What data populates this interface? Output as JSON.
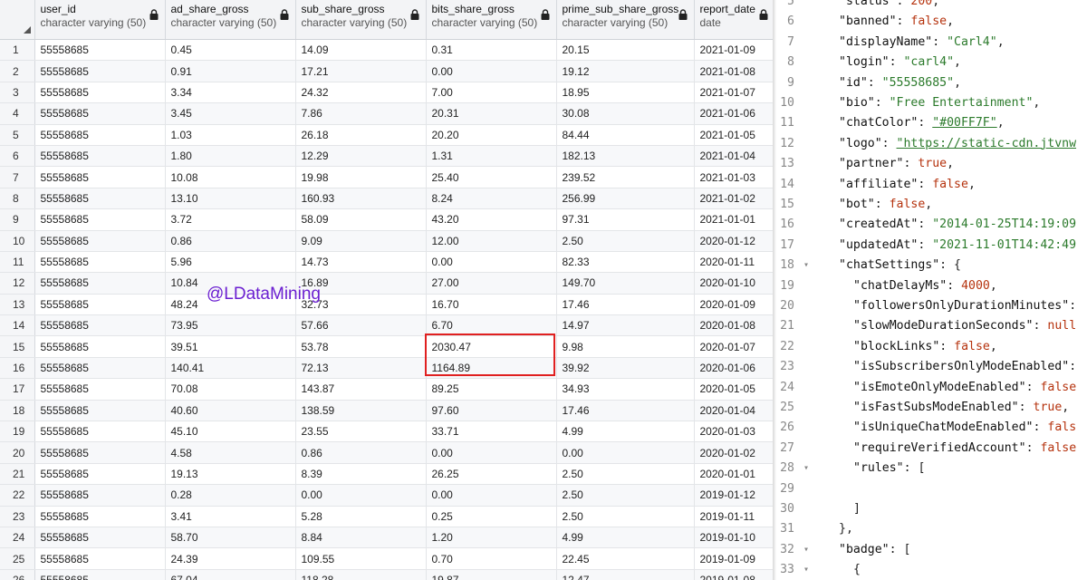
{
  "grid": {
    "columns": [
      {
        "name": "user_id",
        "type": "character varying (50)",
        "locked": true
      },
      {
        "name": "ad_share_gross",
        "type": "character varying (50)",
        "locked": true
      },
      {
        "name": "sub_share_gross",
        "type": "character varying (50)",
        "locked": true
      },
      {
        "name": "bits_share_gross",
        "type": "character varying (50)",
        "locked": true
      },
      {
        "name": "prime_sub_share_gross",
        "type": "character varying (50)",
        "locked": true
      },
      {
        "name": "report_date",
        "type": "date",
        "locked": true
      }
    ],
    "rows": [
      [
        "1",
        "55558685",
        "0.45",
        "14.09",
        "0.31",
        "20.15",
        "2021-01-09"
      ],
      [
        "2",
        "55558685",
        "0.91",
        "17.21",
        "0.00",
        "19.12",
        "2021-01-08"
      ],
      [
        "3",
        "55558685",
        "3.34",
        "24.32",
        "7.00",
        "18.95",
        "2021-01-07"
      ],
      [
        "4",
        "55558685",
        "3.45",
        "7.86",
        "20.31",
        "30.08",
        "2021-01-06"
      ],
      [
        "5",
        "55558685",
        "1.03",
        "26.18",
        "20.20",
        "84.44",
        "2021-01-05"
      ],
      [
        "6",
        "55558685",
        "1.80",
        "12.29",
        "1.31",
        "182.13",
        "2021-01-04"
      ],
      [
        "7",
        "55558685",
        "10.08",
        "19.98",
        "25.40",
        "239.52",
        "2021-01-03"
      ],
      [
        "8",
        "55558685",
        "13.10",
        "160.93",
        "8.24",
        "256.99",
        "2021-01-02"
      ],
      [
        "9",
        "55558685",
        "3.72",
        "58.09",
        "43.20",
        "97.31",
        "2021-01-01"
      ],
      [
        "10",
        "55558685",
        "0.86",
        "9.09",
        "12.00",
        "2.50",
        "2020-01-12"
      ],
      [
        "11",
        "55558685",
        "5.96",
        "14.73",
        "0.00",
        "82.33",
        "2020-01-11"
      ],
      [
        "12",
        "55558685",
        "10.84",
        "16.89",
        "27.00",
        "149.70",
        "2020-01-10"
      ],
      [
        "13",
        "55558685",
        "48.24",
        "32.73",
        "16.70",
        "17.46",
        "2020-01-09"
      ],
      [
        "14",
        "55558685",
        "73.95",
        "57.66",
        "6.70",
        "14.97",
        "2020-01-08"
      ],
      [
        "15",
        "55558685",
        "39.51",
        "53.78",
        "2030.47",
        "9.98",
        "2020-01-07"
      ],
      [
        "16",
        "55558685",
        "140.41",
        "72.13",
        "1164.89",
        "39.92",
        "2020-01-06"
      ],
      [
        "17",
        "55558685",
        "70.08",
        "143.87",
        "89.25",
        "34.93",
        "2020-01-05"
      ],
      [
        "18",
        "55558685",
        "40.60",
        "138.59",
        "97.60",
        "17.46",
        "2020-01-04"
      ],
      [
        "19",
        "55558685",
        "45.10",
        "23.55",
        "33.71",
        "4.99",
        "2020-01-03"
      ],
      [
        "20",
        "55558685",
        "4.58",
        "0.86",
        "0.00",
        "0.00",
        "2020-01-02"
      ],
      [
        "21",
        "55558685",
        "19.13",
        "8.39",
        "26.25",
        "2.50",
        "2020-01-01"
      ],
      [
        "22",
        "55558685",
        "0.28",
        "0.00",
        "0.00",
        "2.50",
        "2019-01-12"
      ],
      [
        "23",
        "55558685",
        "3.41",
        "5.28",
        "0.25",
        "2.50",
        "2019-01-11"
      ],
      [
        "24",
        "55558685",
        "58.70",
        "8.84",
        "1.20",
        "4.99",
        "2019-01-10"
      ],
      [
        "25",
        "55558685",
        "24.39",
        "109.55",
        "0.70",
        "22.45",
        "2019-01-09"
      ],
      [
        "26",
        "55558685",
        "67.04",
        "118.28",
        "19.87",
        "12.47",
        "2019-01-08"
      ]
    ],
    "watermark": "@LDataMining"
  },
  "code": {
    "lines": [
      {
        "n": "5",
        "fold": false,
        "tokens": [
          [
            "k",
            "\"status\""
          ],
          [
            "p",
            ": "
          ],
          [
            "n",
            "200"
          ],
          [
            "p",
            ","
          ]
        ]
      },
      {
        "n": "6",
        "fold": false,
        "tokens": [
          [
            "k",
            "\"banned\""
          ],
          [
            "p",
            ": "
          ],
          [
            "b",
            "false"
          ],
          [
            "p",
            ","
          ]
        ]
      },
      {
        "n": "7",
        "fold": false,
        "tokens": [
          [
            "k",
            "\"displayName\""
          ],
          [
            "p",
            ": "
          ],
          [
            "s",
            "\"Carl4\""
          ],
          [
            "p",
            ","
          ]
        ]
      },
      {
        "n": "8",
        "fold": false,
        "tokens": [
          [
            "k",
            "\"login\""
          ],
          [
            "p",
            ": "
          ],
          [
            "s",
            "\"carl4\""
          ],
          [
            "p",
            ","
          ]
        ]
      },
      {
        "n": "9",
        "fold": false,
        "tokens": [
          [
            "k",
            "\"id\""
          ],
          [
            "p",
            ": "
          ],
          [
            "s",
            "\"55558685\""
          ],
          [
            "p",
            ","
          ]
        ]
      },
      {
        "n": "10",
        "fold": false,
        "tokens": [
          [
            "k",
            "\"bio\""
          ],
          [
            "p",
            ": "
          ],
          [
            "s",
            "\"Free Entertainment\""
          ],
          [
            "p",
            ","
          ]
        ]
      },
      {
        "n": "11",
        "fold": false,
        "tokens": [
          [
            "k",
            "\"chatColor\""
          ],
          [
            "p",
            ": "
          ],
          [
            "u",
            "\"#00FF7F\""
          ],
          [
            "p",
            ","
          ]
        ]
      },
      {
        "n": "12",
        "fold": false,
        "tokens": [
          [
            "k",
            "\"logo\""
          ],
          [
            "p",
            ": "
          ],
          [
            "u",
            "\"https://static-cdn.jtvnw"
          ]
        ]
      },
      {
        "n": "13",
        "fold": false,
        "tokens": [
          [
            "k",
            "\"partner\""
          ],
          [
            "p",
            ": "
          ],
          [
            "b",
            "true"
          ],
          [
            "p",
            ","
          ]
        ]
      },
      {
        "n": "14",
        "fold": false,
        "tokens": [
          [
            "k",
            "\"affiliate\""
          ],
          [
            "p",
            ": "
          ],
          [
            "b",
            "false"
          ],
          [
            "p",
            ","
          ]
        ]
      },
      {
        "n": "15",
        "fold": false,
        "tokens": [
          [
            "k",
            "\"bot\""
          ],
          [
            "p",
            ": "
          ],
          [
            "b",
            "false"
          ],
          [
            "p",
            ","
          ]
        ]
      },
      {
        "n": "16",
        "fold": false,
        "tokens": [
          [
            "k",
            "\"createdAt\""
          ],
          [
            "p",
            ": "
          ],
          [
            "s",
            "\"2014-01-25T14:19:09"
          ]
        ]
      },
      {
        "n": "17",
        "fold": false,
        "tokens": [
          [
            "k",
            "\"updatedAt\""
          ],
          [
            "p",
            ": "
          ],
          [
            "s",
            "\"2021-11-01T14:42:49"
          ]
        ]
      },
      {
        "n": "18",
        "fold": true,
        "tokens": [
          [
            "k",
            "\"chatSettings\""
          ],
          [
            "p",
            ": {"
          ]
        ]
      },
      {
        "n": "19",
        "fold": false,
        "indent": 1,
        "tokens": [
          [
            "k",
            "\"chatDelayMs\""
          ],
          [
            "p",
            ": "
          ],
          [
            "n",
            "4000"
          ],
          [
            "p",
            ","
          ]
        ]
      },
      {
        "n": "20",
        "fold": false,
        "indent": 1,
        "tokens": [
          [
            "k",
            "\"followersOnlyDurationMinutes\""
          ],
          [
            "p",
            ":"
          ]
        ]
      },
      {
        "n": "21",
        "fold": false,
        "indent": 1,
        "tokens": [
          [
            "k",
            "\"slowModeDurationSeconds\""
          ],
          [
            "p",
            ": "
          ],
          [
            "b",
            "null"
          ]
        ]
      },
      {
        "n": "22",
        "fold": false,
        "indent": 1,
        "tokens": [
          [
            "k",
            "\"blockLinks\""
          ],
          [
            "p",
            ": "
          ],
          [
            "b",
            "false"
          ],
          [
            "p",
            ","
          ]
        ]
      },
      {
        "n": "23",
        "fold": false,
        "indent": 1,
        "tokens": [
          [
            "k",
            "\"isSubscribersOnlyModeEnabled\""
          ],
          [
            "p",
            ":"
          ]
        ]
      },
      {
        "n": "24",
        "fold": false,
        "indent": 1,
        "tokens": [
          [
            "k",
            "\"isEmoteOnlyModeEnabled\""
          ],
          [
            "p",
            ": "
          ],
          [
            "b",
            "false"
          ]
        ]
      },
      {
        "n": "25",
        "fold": false,
        "indent": 1,
        "tokens": [
          [
            "k",
            "\"isFastSubsModeEnabled\""
          ],
          [
            "p",
            ": "
          ],
          [
            "b",
            "true"
          ],
          [
            "p",
            ","
          ]
        ]
      },
      {
        "n": "26",
        "fold": false,
        "indent": 1,
        "tokens": [
          [
            "k",
            "\"isUniqueChatModeEnabled\""
          ],
          [
            "p",
            ": "
          ],
          [
            "b",
            "fals"
          ]
        ]
      },
      {
        "n": "27",
        "fold": false,
        "indent": 1,
        "tokens": [
          [
            "k",
            "\"requireVerifiedAccount\""
          ],
          [
            "p",
            ": "
          ],
          [
            "b",
            "false"
          ]
        ]
      },
      {
        "n": "28",
        "fold": true,
        "indent": 1,
        "tokens": [
          [
            "k",
            "\"rules\""
          ],
          [
            "p",
            ": ["
          ]
        ]
      },
      {
        "n": "29",
        "fold": false,
        "tokens": []
      },
      {
        "n": "30",
        "fold": false,
        "indent": 1,
        "tokens": [
          [
            "p",
            "]"
          ]
        ]
      },
      {
        "n": "31",
        "fold": false,
        "tokens": [
          [
            "p",
            "},"
          ]
        ]
      },
      {
        "n": "32",
        "fold": true,
        "tokens": [
          [
            "k",
            "\"badge\""
          ],
          [
            "p",
            ": ["
          ]
        ]
      },
      {
        "n": "33",
        "fold": true,
        "indent": 1,
        "tokens": [
          [
            "p",
            "{"
          ]
        ]
      }
    ]
  }
}
